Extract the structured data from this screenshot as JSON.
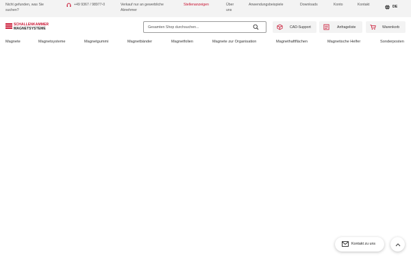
{
  "colors": {
    "accent": "#c8102e",
    "topbar_bg": "#f3f3f3"
  },
  "topbar": {
    "not_found": "Nicht gefunden, was Sie suchen?",
    "phone": "+49 9367 / 98977-0",
    "phone_icon": "headset-icon",
    "trade_notice": "Verkauf nur an gewerbliche Abnehmer",
    "jobs": "Stellenanzeigen",
    "about": "Über uns",
    "examples": "Anwendungsbeispiele",
    "downloads": "Downloads",
    "account": "Konto",
    "contact": "Kontakt",
    "language": "DE",
    "language_icon": "globe-icon"
  },
  "logo": {
    "line1": "SCHALLENKAMMER",
    "line2": "MAGNETSYSTEME"
  },
  "search": {
    "placeholder": "Gesamten Shop durchsuchen...",
    "icon": "search-icon"
  },
  "header_buttons": {
    "cad": "CAD-Support",
    "inquiry": "Anfrageliste",
    "cart": "Warenkorb"
  },
  "nav": {
    "items": [
      "Magnete",
      "Magnetsysteme",
      "Magnetgummi",
      "Magnetbänder",
      "Magnetfolien",
      "Magnete zur Organisation",
      "Magnethaftflächen",
      "Magnetische Helfer",
      "Sonderposten"
    ]
  },
  "floating": {
    "contact_label": "Kontakt zu uns",
    "contact_icon": "mail-icon",
    "to_top_icon": "chevron-up-icon"
  }
}
